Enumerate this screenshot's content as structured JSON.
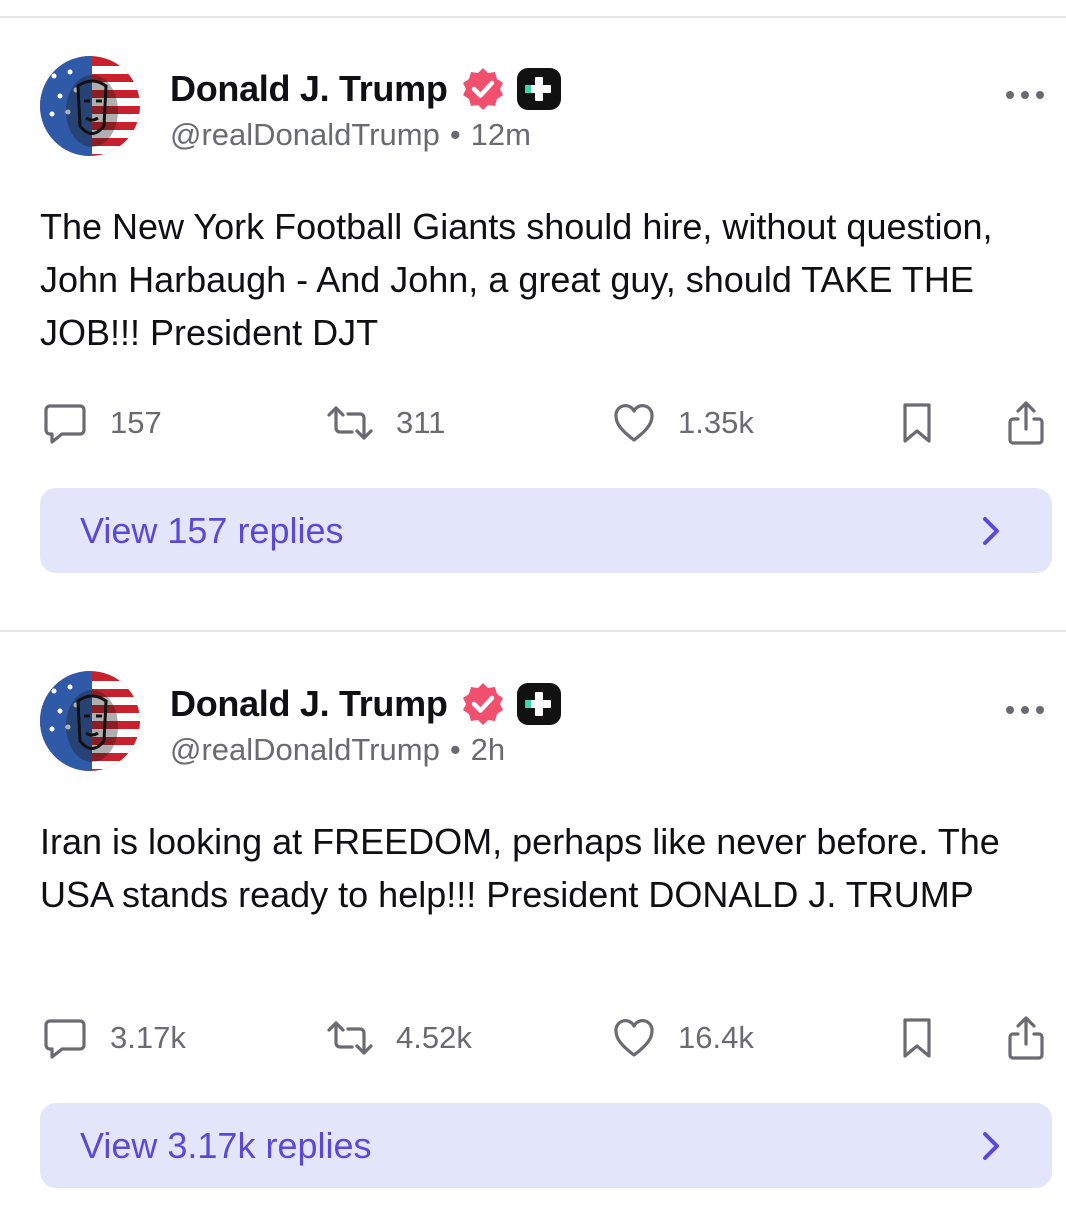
{
  "posts": [
    {
      "author_name": "Donald J. Trump",
      "handle": "@realDonaldTrump",
      "separator": "•",
      "time": "12m",
      "text": "The New York Football Giants should hire, without question, John Harbaugh - And John, a great guy, should TAKE THE JOB!!! President DJT",
      "replies": "157",
      "reposts": "311",
      "likes": "1.35k",
      "view_replies_label": "View 157 replies"
    },
    {
      "author_name": "Donald J. Trump",
      "handle": "@realDonaldTrump",
      "separator": "•",
      "time": "2h",
      "text": "Iran is looking at FREEDOM, perhaps like never before. The USA stands ready to help!!! President DONALD J. TRUMP",
      "replies": "3.17k",
      "reposts": "4.52k",
      "likes": "16.4k",
      "view_replies_label": "View 3.17k replies"
    }
  ],
  "icons": {
    "verified": "verified-badge-icon",
    "plus_badge": "plus-badge-icon",
    "more": "more-options-icon",
    "reply": "comment-icon",
    "repost": "repost-icon",
    "like": "heart-icon",
    "bookmark": "bookmark-icon",
    "share": "share-icon",
    "chevron": "chevron-right-icon"
  },
  "colors": {
    "verified_badge": "#f0506e",
    "plus_badge": "#111111",
    "reply_pill_bg": "#e3e6fb",
    "reply_pill_text": "#5a48d8",
    "muted_text": "#6a6a73",
    "divider": "#e6e6ea"
  }
}
